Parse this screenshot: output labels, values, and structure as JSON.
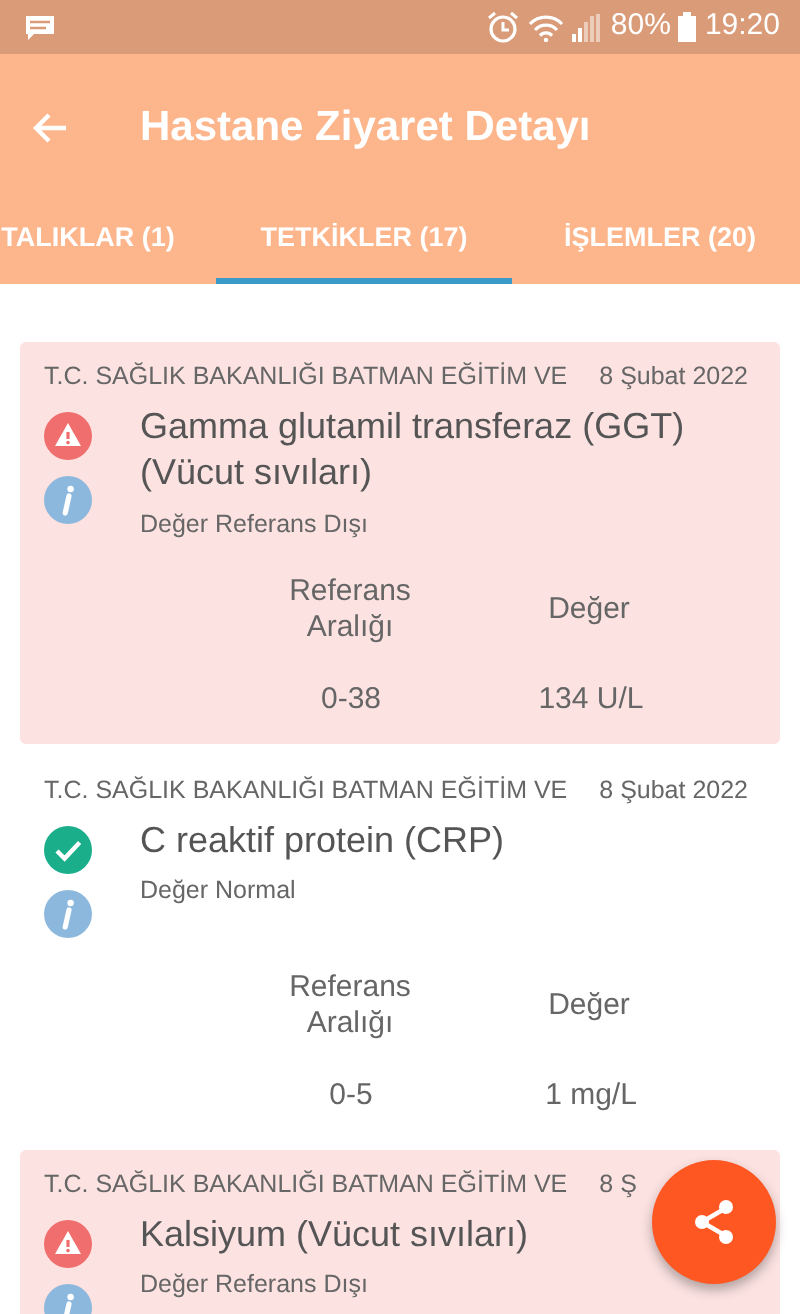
{
  "status_bar": {
    "time": "19:20",
    "battery": "80%"
  },
  "app_bar": {
    "title": "Hastane Ziyaret Detayı"
  },
  "tabs": [
    {
      "label": "TALIKLAR (1)",
      "selected": false
    },
    {
      "label": "TETKİKLER (17)",
      "selected": true
    },
    {
      "label": "İŞLEMLER (20)",
      "selected": false
    }
  ],
  "tests": [
    {
      "kind": "abnormal",
      "institution": "T.C. SAĞLIK BAKANLIĞI BATMAN EĞİTİM VE",
      "date": "8 Şubat 2022",
      "name": "Gamma glutamil transferaz (GGT) (Vücut sıvıları)",
      "status": "Değer Referans Dışı",
      "reference_label": "Referans Aralığı",
      "value_label": "Değer",
      "reference": "0-38",
      "value": "134 U/L"
    },
    {
      "kind": "normal",
      "institution": "T.C. SAĞLIK BAKANLIĞI BATMAN EĞİTİM VE",
      "date": "8 Şubat 2022",
      "name": "C reaktif protein (CRP)",
      "status": "Değer Normal",
      "reference_label": "Referans Aralığı",
      "value_label": "Değer",
      "reference": "0-5",
      "value": "1 mg/L"
    },
    {
      "kind": "abnormal",
      "institution": "T.C. SAĞLIK BAKANLIĞI BATMAN EĞİTİM VE",
      "date": "8 Ş",
      "name": "Kalsiyum (Vücut sıvıları)",
      "status": "Değer Referans Dışı"
    }
  ]
}
